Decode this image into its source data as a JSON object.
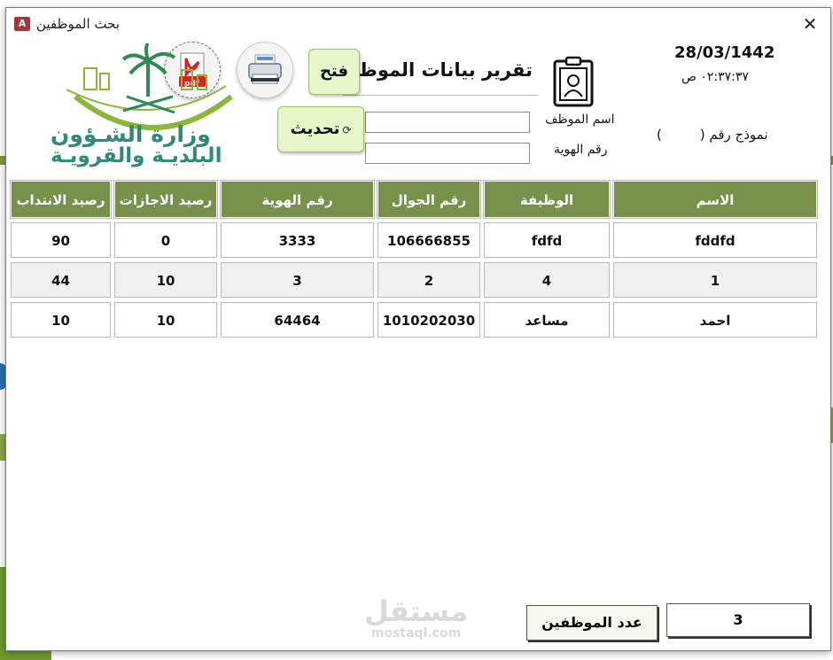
{
  "window": {
    "title": "بحث الموظفين",
    "app_icon": "A"
  },
  "header": {
    "date": "28/03/1442",
    "time": "٠٢:٣٧:٣٧ ص",
    "form_number": "نموذج رقم (         )",
    "report_title": "تقرير بيانات الموظفين",
    "label_employee_name": "اسم الموظف",
    "label_id_number": "رقم الهوية",
    "input_employee_name": "",
    "input_id_number": ""
  },
  "buttons": {
    "open": "فتح",
    "refresh": "تحديث",
    "pdf": "pdf"
  },
  "logo": {
    "line1": "وزارة الشـؤون",
    "line2": "البلديـة والقرويـة"
  },
  "table": {
    "columns": [
      "الاسم",
      "الوظيفة",
      "رقم الجوال",
      "رقم الهوية",
      "رصيد الاجازات",
      "رصيد الانتداب"
    ],
    "rows": [
      [
        "fddfd",
        "fdfd",
        "106666855",
        "3333",
        "0",
        "90"
      ],
      [
        "1",
        "4",
        "2",
        "3",
        "10",
        "44"
      ],
      [
        "احمد",
        "مساعد",
        "1010202030",
        "64464",
        "10",
        "10"
      ]
    ]
  },
  "footer": {
    "employee_count": "3",
    "employee_count_label": "عدد الموظفين"
  },
  "watermark": {
    "arabic": "مستقل",
    "latin": "mostaql.com"
  },
  "colors": {
    "header_bg": "#77904a",
    "button_bg": "#e6f6c8",
    "logo_teal": "#2f8a7a",
    "logo_green": "#8ab63a"
  }
}
